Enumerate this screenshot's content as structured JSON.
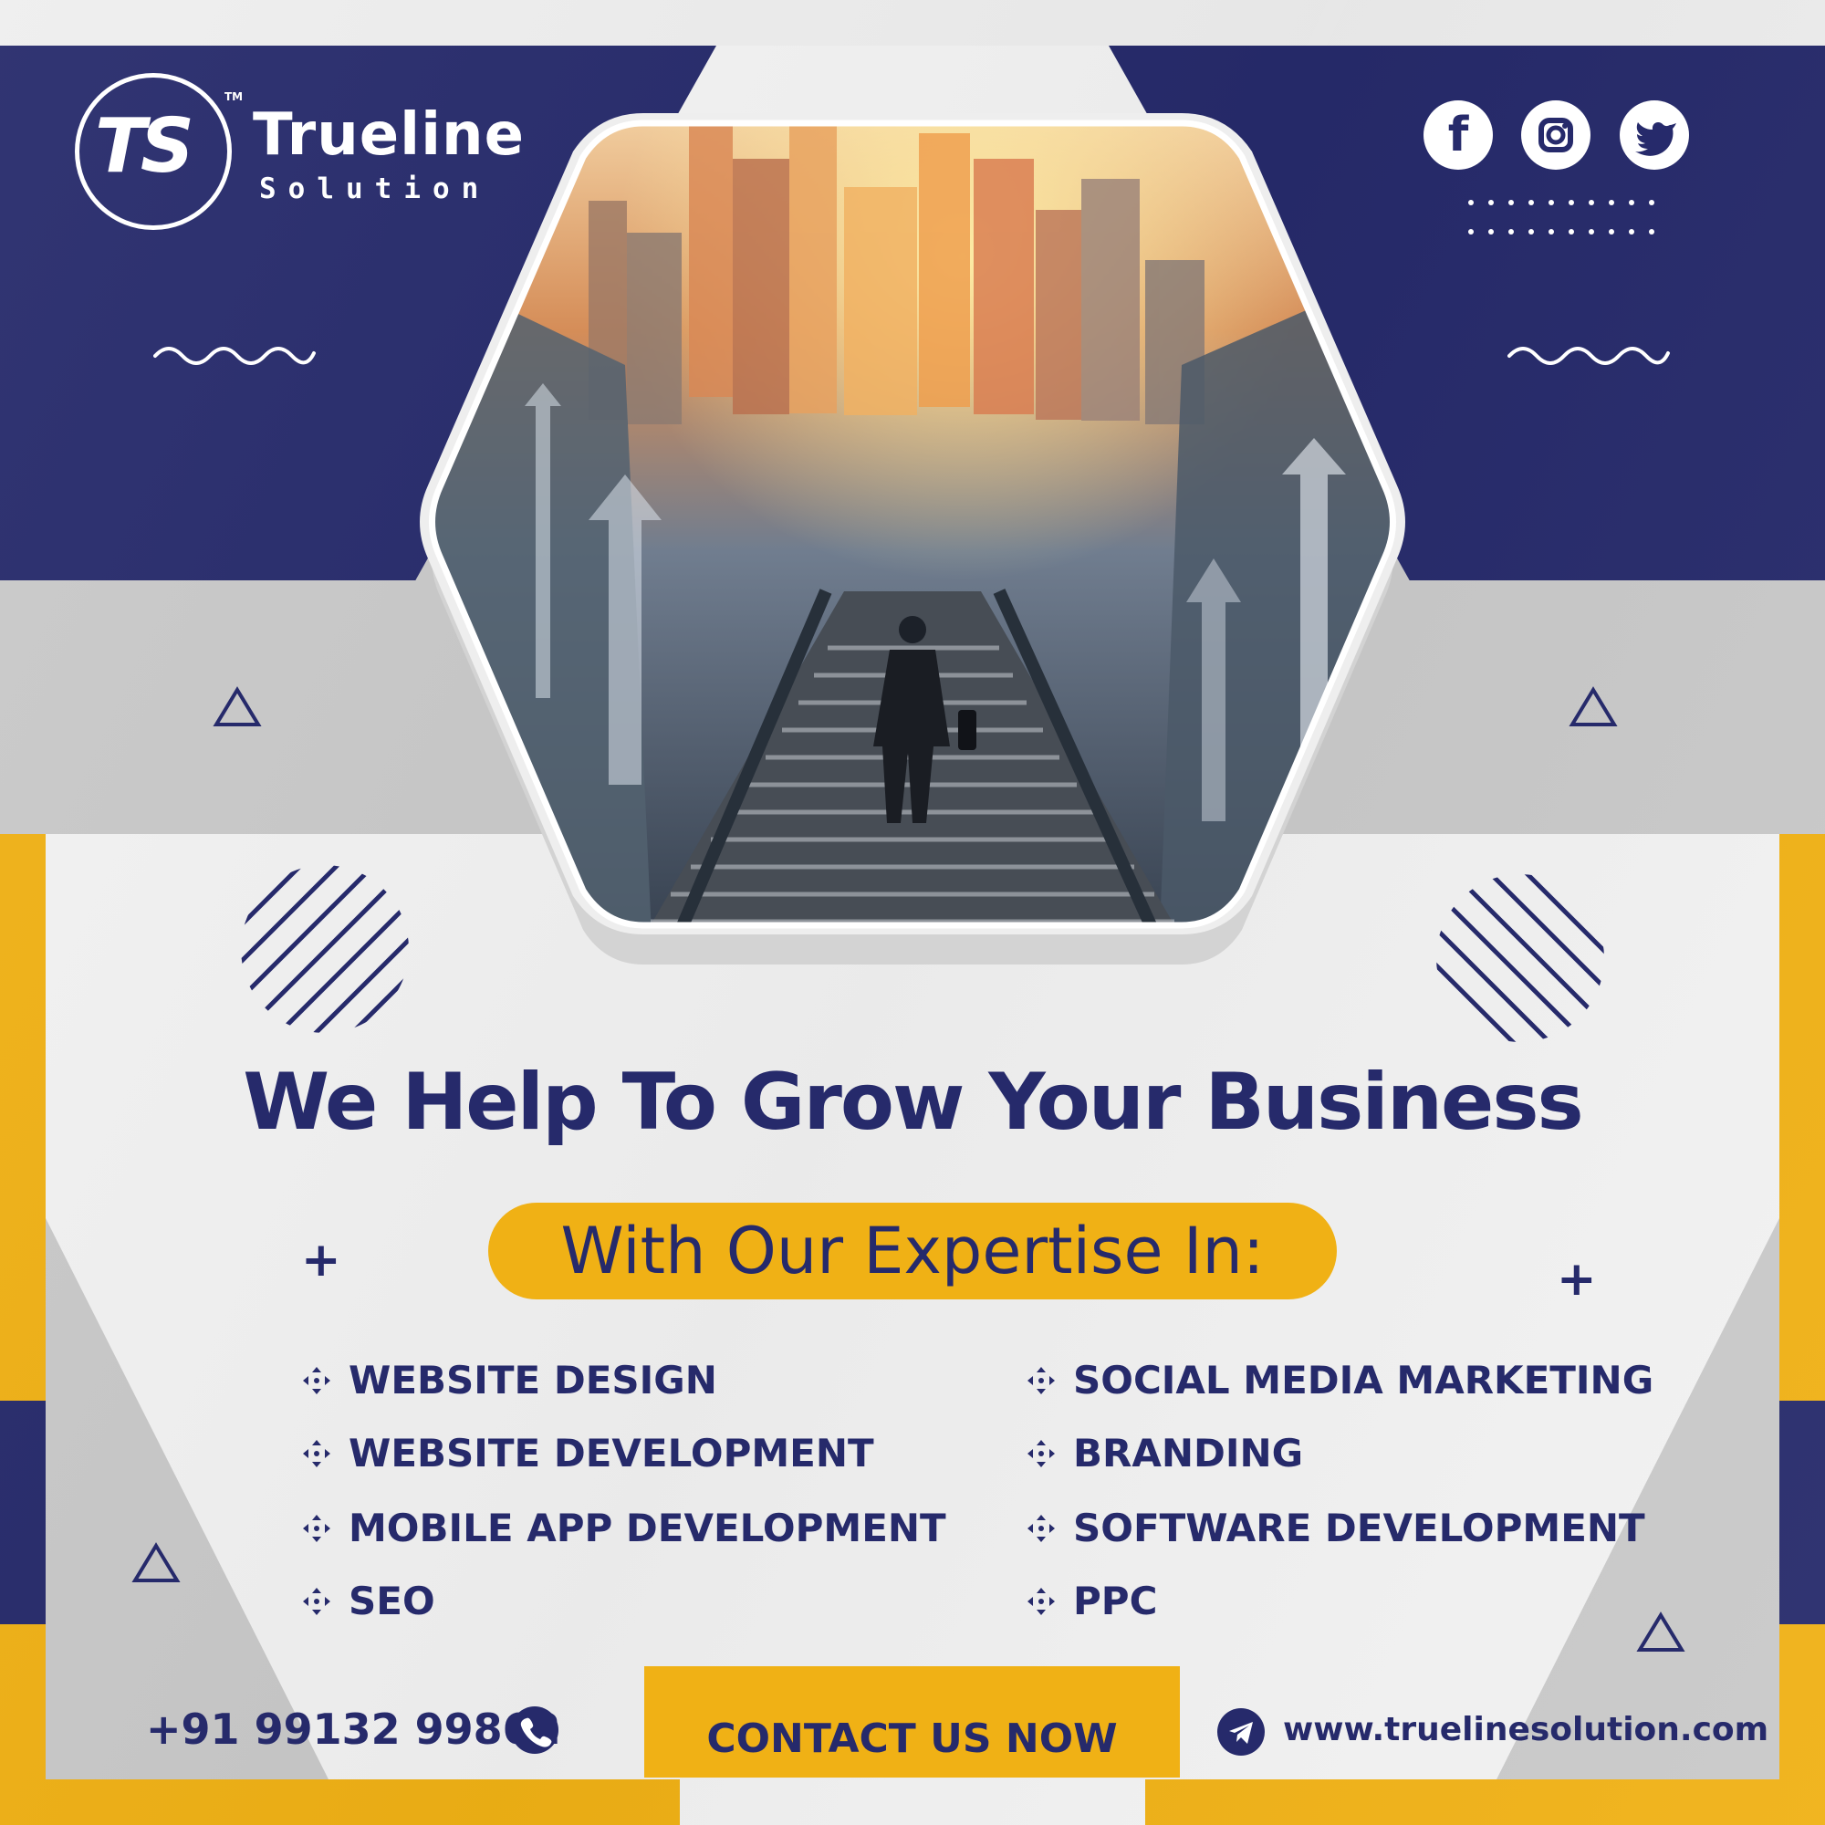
{
  "brand": {
    "mark": "TS",
    "tm": "TM",
    "name": "Trueline",
    "tagline": "Solution"
  },
  "social": [
    {
      "icon": "facebook-icon",
      "label": "f"
    },
    {
      "icon": "instagram-icon",
      "label": ""
    },
    {
      "icon": "twitter-icon",
      "label": ""
    }
  ],
  "headline": "We Help To Grow Your Business",
  "subheadline": "With Our Expertise In:",
  "services": {
    "left": [
      "WEBSITE DESIGN",
      "WEBSITE DEVELOPMENT",
      "MOBILE APP DEVELOPMENT",
      "SEO"
    ],
    "right": [
      "SOCIAL MEDIA MARKETING",
      "BRANDING",
      "SOFTWARE DEVELOPMENT",
      "PPC"
    ]
  },
  "footer": {
    "phone": "+91 99132 99862",
    "phone_icon": "phone-icon",
    "cta": "CONTACT US NOW",
    "website": "www.truelinesolution.com",
    "website_icon": "telegram-icon"
  },
  "colors": {
    "navy": "#262a6b",
    "yellow": "#f0b115",
    "grey": "#c9c9c9",
    "paper": "#f3f3f3"
  }
}
